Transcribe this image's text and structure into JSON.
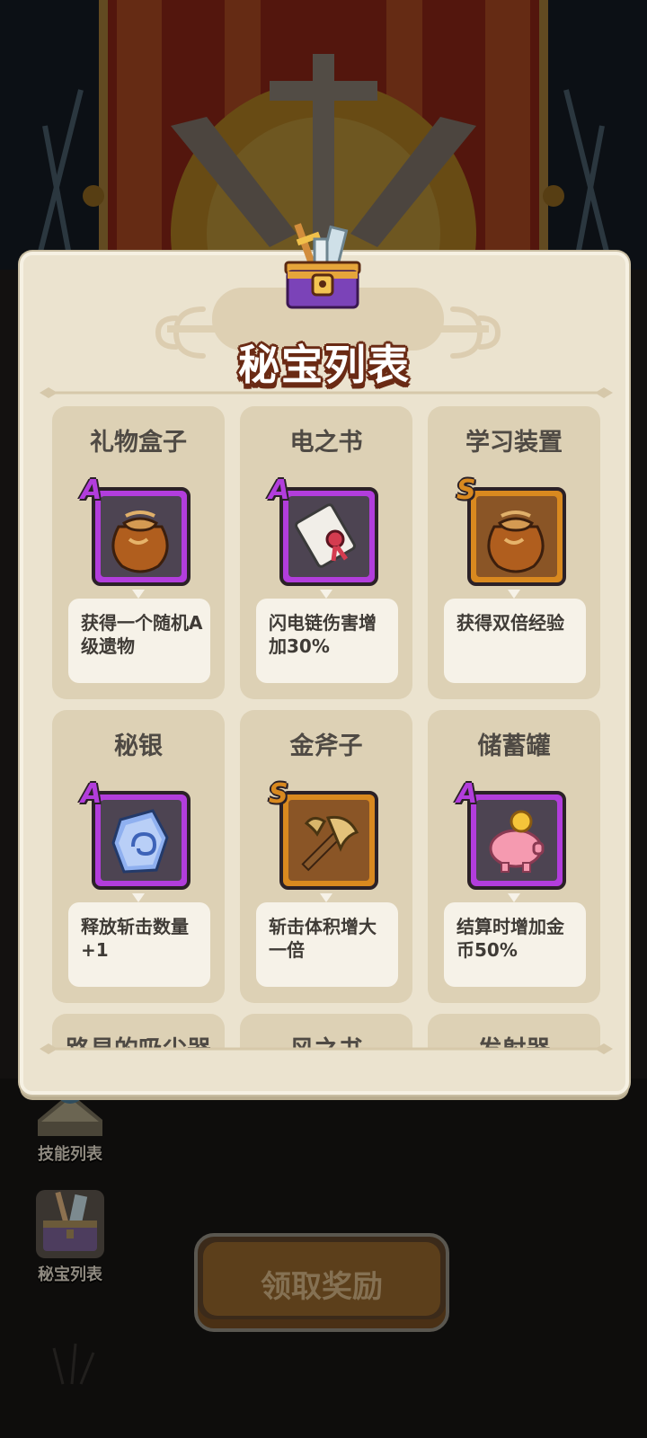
{
  "panel": {
    "title": "秘宝列表",
    "treasures": [
      {
        "name": "礼物盒子",
        "grade": "A",
        "icon": "treasure-bag-icon",
        "description": "获得一个随机A级遗物"
      },
      {
        "name": "电之书",
        "grade": "A",
        "icon": "scroll-icon",
        "description": "闪电链伤害增加30%"
      },
      {
        "name": "学习装置",
        "grade": "S",
        "icon": "treasure-bag-icon",
        "description": "获得双倍经验"
      },
      {
        "name": "秘银",
        "grade": "A",
        "icon": "mithril-rune-icon",
        "description": "释放斩击数量+1"
      },
      {
        "name": "金斧子",
        "grade": "S",
        "icon": "golden-axe-icon",
        "description": "斩击体积增大一倍"
      },
      {
        "name": "储蓄罐",
        "grade": "A",
        "icon": "piggy-bank-icon",
        "description": "结算时增加金币50%"
      },
      {
        "name": "路易的吸尘器",
        "grade": "",
        "icon": "",
        "description": ""
      },
      {
        "name": "风之书",
        "grade": "",
        "icon": "",
        "description": ""
      },
      {
        "name": "发射器",
        "grade": "",
        "icon": "",
        "description": ""
      }
    ]
  },
  "side_menu": {
    "skills_label": "技能列表",
    "treasures_label": "秘宝列表"
  },
  "claim_button_label": "领取奖励",
  "colors": {
    "grade_a": "#b23ddc",
    "grade_s": "#d9891f",
    "panel_bg": "#ebe3cf",
    "card_bg": "#ddd1b5"
  }
}
